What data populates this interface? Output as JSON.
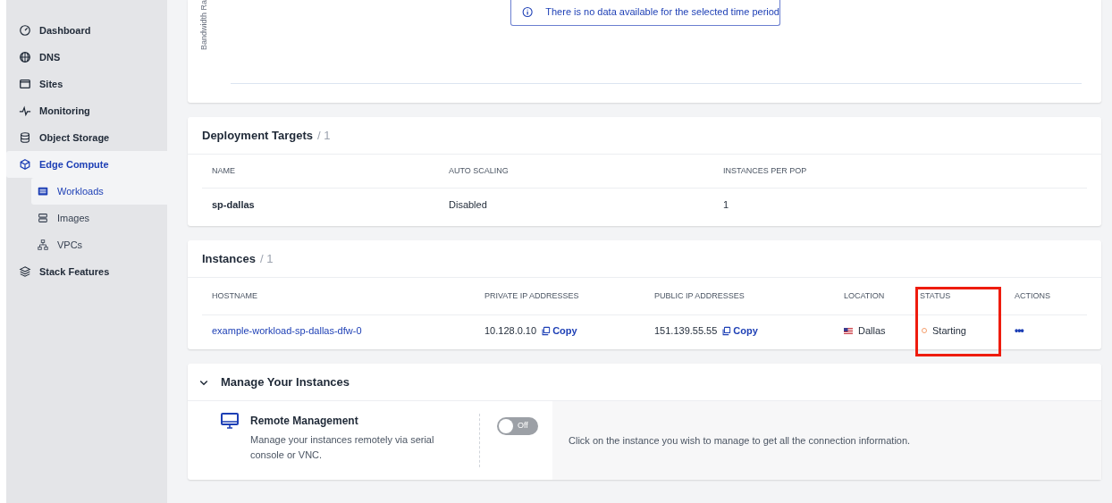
{
  "sidebar": {
    "items": [
      {
        "label": "Dashboard",
        "selected": false
      },
      {
        "label": "DNS",
        "selected": false
      },
      {
        "label": "Sites",
        "selected": false
      },
      {
        "label": "Monitoring",
        "selected": false
      },
      {
        "label": "Object Storage",
        "selected": false
      },
      {
        "label": "Edge Compute",
        "selected": true,
        "children": [
          {
            "label": "Workloads",
            "selected": true
          },
          {
            "label": "Images",
            "selected": false
          },
          {
            "label": "VPCs",
            "selected": false
          }
        ]
      },
      {
        "label": "Stack Features",
        "selected": false
      }
    ]
  },
  "bandwidth_chart": {
    "ylabel": "Bandwidth Ra",
    "notice": "There is no data available for the selected time period"
  },
  "deployment_targets": {
    "title": "Deployment Targets",
    "count": "/ 1",
    "columns": [
      "NAME",
      "AUTO SCALING",
      "INSTANCES PER POP"
    ],
    "rows": [
      [
        "sp-dallas",
        "Disabled",
        "1"
      ]
    ]
  },
  "instances": {
    "title": "Instances",
    "count": "/ 1",
    "columns": [
      "HOSTNAME",
      "PRIVATE IP ADDRESSES",
      "PUBLIC IP ADDRESSES",
      "LOCATION",
      "STATUS",
      "ACTIONS"
    ],
    "rows": [
      {
        "hostname": "example-workload-sp-dallas-dfw-0",
        "private_ip": "10.128.0.10",
        "private_copy_label": "Copy",
        "public_ip": "151.139.55.55",
        "public_copy_label": "Copy",
        "location": "Dallas",
        "status": "Starting",
        "actions": "•••"
      }
    ]
  },
  "manage": {
    "title": "Manage Your Instances",
    "expanded": true,
    "remote": {
      "title": "Remote Management",
      "description": "Manage your instances remotely via serial console or VNC.",
      "toggle_label": "Off",
      "on": false,
      "hint": "Click on the instance you wish to manage to get all the connection information."
    }
  }
}
